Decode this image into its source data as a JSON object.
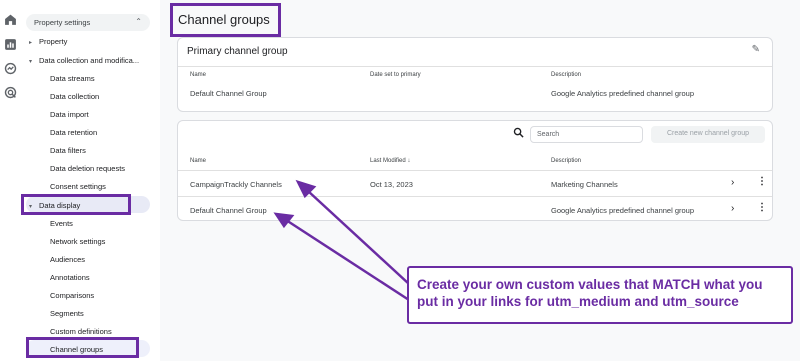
{
  "rail": {
    "icons": [
      "home-icon",
      "reports-icon",
      "explore-icon",
      "advertising-icon"
    ]
  },
  "sidebar": {
    "header": "Property settings",
    "items": [
      {
        "label": "Property",
        "level": 1,
        "arrow": "▸"
      },
      {
        "label": "Data collection and modifica...",
        "level": 1,
        "arrow": "▾"
      },
      {
        "label": "Data streams",
        "level": 2
      },
      {
        "label": "Data collection",
        "level": 2
      },
      {
        "label": "Data import",
        "level": 2
      },
      {
        "label": "Data retention",
        "level": 2
      },
      {
        "label": "Data filters",
        "level": 2
      },
      {
        "label": "Data deletion requests",
        "level": 2
      },
      {
        "label": "Consent settings",
        "level": 2
      },
      {
        "label": "Data display",
        "level": 1,
        "arrow": "▾"
      },
      {
        "label": "Events",
        "level": 2
      },
      {
        "label": "Network settings",
        "level": 2
      },
      {
        "label": "Audiences",
        "level": 2
      },
      {
        "label": "Annotations",
        "level": 2
      },
      {
        "label": "Comparisons",
        "level": 2
      },
      {
        "label": "Segments",
        "level": 2
      },
      {
        "label": "Custom definitions",
        "level": 2
      },
      {
        "label": "Channel groups",
        "level": 2
      }
    ]
  },
  "main": {
    "title": "Channel groups",
    "primary": {
      "title": "Primary channel group",
      "columns": [
        "Name",
        "Date set to primary",
        "Description"
      ],
      "row": {
        "name": "Default Channel Group",
        "date": "",
        "description": "Google Analytics predefined channel group"
      }
    },
    "groups": {
      "search_placeholder": "Search",
      "new_button": "Create new channel group",
      "columns": {
        "name": "Name",
        "modified": "Last Modified",
        "description": "Description"
      },
      "rows": [
        {
          "name": "CampaignTrackly Channels",
          "modified": "Oct 13, 2023",
          "description": "Marketing Channels"
        },
        {
          "name": "Default Channel Group",
          "modified": "",
          "description": "Google Analytics predefined channel group"
        }
      ]
    }
  },
  "annotation": {
    "line1": "Create your own custom values that MATCH what you",
    "line2": "put in your links for utm_medium and utm_source",
    "color": "#6a2ca3"
  }
}
